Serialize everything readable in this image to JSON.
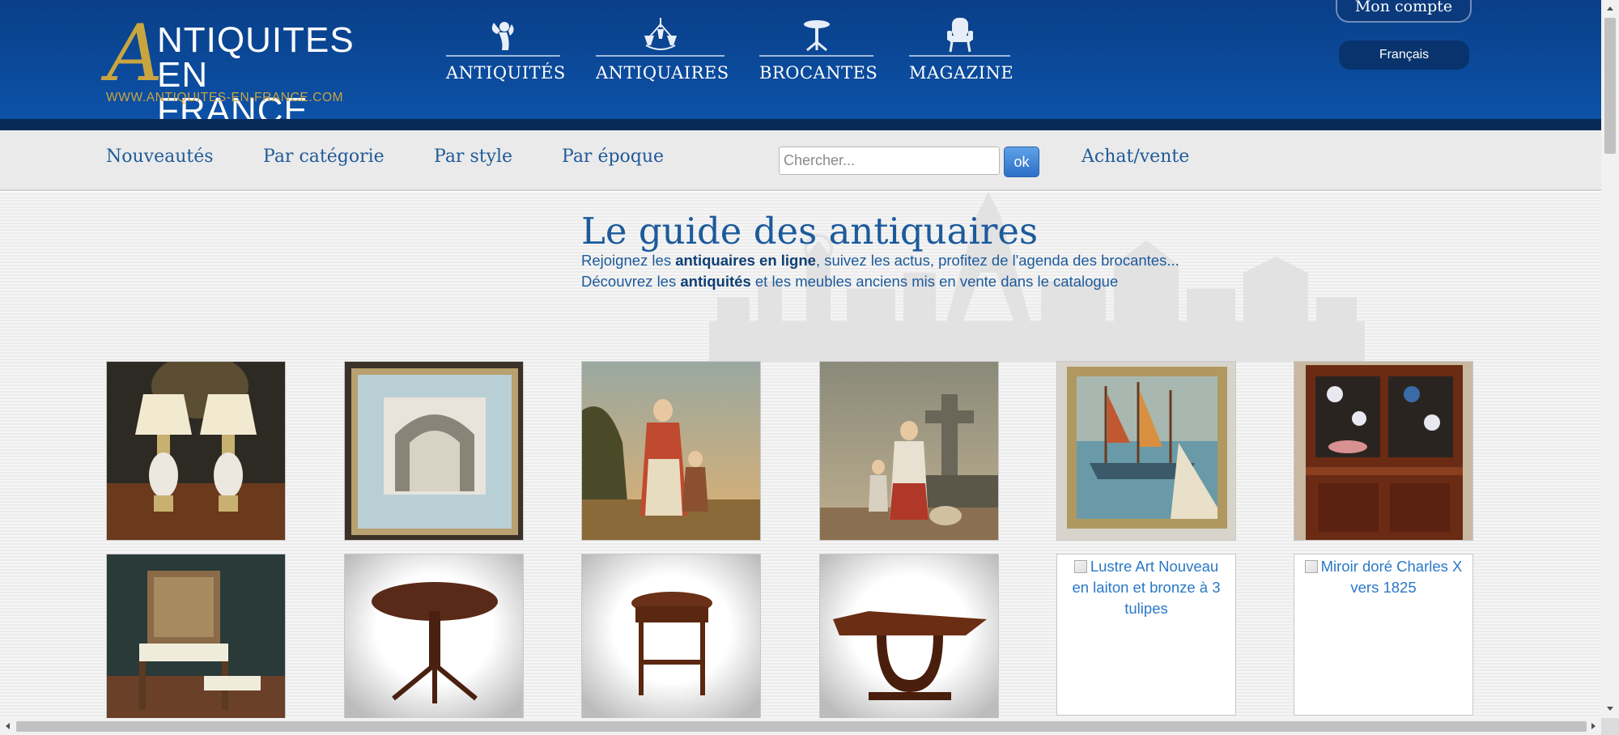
{
  "header": {
    "logo": {
      "letter": "A",
      "line1": "NTIQUITES",
      "line2": "EN FRANCE",
      "url": "WWW.ANTIQUITES-EN-FRANCE.COM"
    },
    "nav": [
      {
        "label": "ANTIQUITÉS",
        "icon": "cherub-icon"
      },
      {
        "label": "ANTIQUAIRES",
        "icon": "chandelier-icon"
      },
      {
        "label": "BROCANTES",
        "icon": "pedestal-table-icon"
      },
      {
        "label": "MAGAZINE",
        "icon": "armchair-icon"
      }
    ],
    "account": "Mon compte",
    "language": "Français"
  },
  "subnav": {
    "links": [
      "Nouveautés",
      "Par catégorie",
      "Par style",
      "Par époque"
    ],
    "search_placeholder": "Chercher...",
    "search_button": "ok",
    "buy_sell": "Achat/vente"
  },
  "main": {
    "title": "Le guide des antiquaires",
    "intro_line1": {
      "pre": "Rejoignez les ",
      "bold": "antiquaires en ligne",
      "post": ", suivez les actus, profitez de l'agenda des brocantes..."
    },
    "intro_line2": {
      "pre": "Découvrez les ",
      "bold": "antiquités",
      "post": " et les meubles anciens mis en vente dans le catalogue"
    }
  },
  "catalog": {
    "broken_items": [
      {
        "alt": "Lustre Art Nouveau en laiton et bronze à 3 tulipes"
      },
      {
        "alt": "Miroir doré Charles X vers 1825"
      }
    ]
  },
  "colors": {
    "header_blue": "#0b4a9b",
    "link_blue": "#1f5a98",
    "gold": "#c9a53f"
  }
}
